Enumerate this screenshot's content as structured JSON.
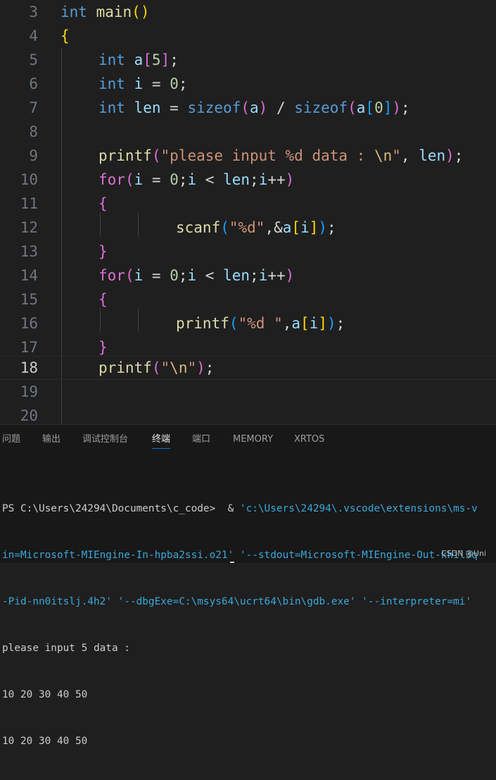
{
  "editor": {
    "line_numbers": [
      "3",
      "4",
      "5",
      "6",
      "7",
      "8",
      "9",
      "10",
      "11",
      "12",
      "13",
      "14",
      "15",
      "16",
      "17",
      "18",
      "19",
      "20"
    ],
    "current_line": "18",
    "code": {
      "l3": [
        "int",
        "main",
        "(",
        ")"
      ],
      "l4": [
        "{"
      ],
      "l5": [
        "int",
        "a",
        "[",
        "5",
        "]",
        ";"
      ],
      "l6": [
        "int",
        "i",
        " = ",
        "0",
        ";"
      ],
      "l7": [
        "int",
        "len",
        " = ",
        "sizeof",
        "(",
        "a",
        ")",
        " / ",
        "sizeof",
        "(",
        "a",
        "[",
        "0",
        "]",
        ")",
        ";"
      ],
      "l9": [
        "printf",
        "(",
        "\"please input %d data : ",
        "\\n",
        "\"",
        ", ",
        "len",
        ")",
        ";"
      ],
      "l10": [
        "for",
        "(",
        "i",
        " = ",
        "0",
        ";",
        "i",
        " < ",
        "len",
        ";",
        "i",
        "++",
        ")"
      ],
      "l11": [
        "{"
      ],
      "l12": [
        "scanf",
        "(",
        "\"%d\"",
        ",&",
        "a",
        "[",
        "i",
        "]",
        ")",
        ";"
      ],
      "l13": [
        "}"
      ],
      "l14": [
        "for",
        "(",
        "i",
        " = ",
        "0",
        ";",
        "i",
        " < ",
        "len",
        ";",
        "i",
        "++",
        ")"
      ],
      "l15": [
        "{"
      ],
      "l16": [
        "printf",
        "(",
        "\"%d \"",
        ",",
        "a",
        "[",
        "i",
        "]",
        ")",
        ";"
      ],
      "l17": [
        "}"
      ],
      "l18": [
        "printf",
        "(",
        "\"",
        "\\n",
        "\"",
        ")",
        ";"
      ]
    }
  },
  "panel": {
    "tabs": [
      "问题",
      "输出",
      "调试控制台",
      "终端",
      "端口",
      "MEMORY",
      "XRTOS"
    ],
    "active_tab": "终端",
    "terminal": {
      "line1_prompt": "PS C:\\Users\\24294\\Documents\\c_code>  & ",
      "line1_str": "'c:\\Users\\24294\\.vscode\\extensions\\ms-v",
      "line2": "in=Microsoft-MIEngine-In-hpba2ssi.o21' '--stdout=Microsoft-MIEngine-Out-khil3q",
      "line3": "-Pid-nn0itslj.4h2' '--dbgExe=C:\\msys64\\ucrt64\\bin\\gdb.exe' '--interpreter=mi'",
      "line4": "please input 5 data :",
      "line5": "10 20 30 40 50",
      "line6": "10 20 30 40 50"
    },
    "watermark": "CSDN @Uni"
  },
  "colors": {
    "background": "#1f1f1f",
    "keyword": "#569cd6",
    "function": "#dcdcaa",
    "variable": "#9cdcfe",
    "number": "#b5cea8",
    "string": "#ce9178",
    "bracket_gold": "#ffd700",
    "bracket_purple": "#da70d6",
    "bracket_blue": "#179fff",
    "terminal_string": "#3aa7d9",
    "active_tab_underline": "#0078d4"
  }
}
